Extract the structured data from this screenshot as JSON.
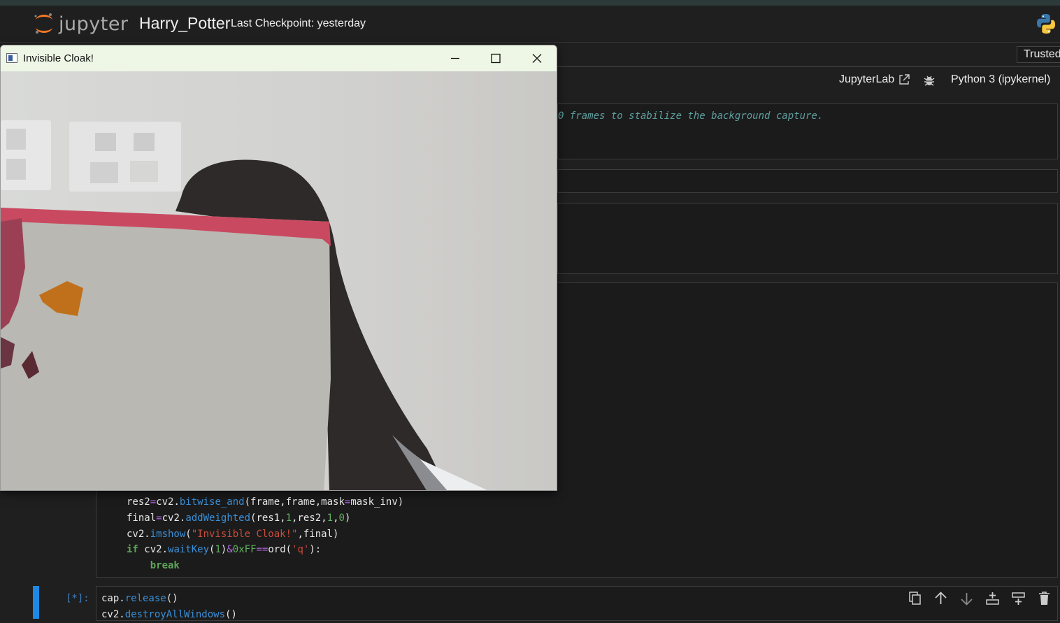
{
  "header": {
    "logo_text": "jupyter",
    "notebook_title": "Harry_Potter",
    "checkpoint": "Last Checkpoint: yesterday"
  },
  "toolbar": {
    "trusted_label": "Trusted"
  },
  "kernel_bar": {
    "jupyterlab_label": "JupyterLab",
    "kernel_name": "Python 3 (ipykernel)"
  },
  "cells": {
    "comment_fragment": "0 frames to stabilize the background capture.",
    "code_lines": [
      "res2=cv2.bitwise_and(frame,frame,mask=mask_inv)",
      "final=cv2.addWeighted(res1,1,res2,1,0)",
      "cv2.imshow(\"Invisible Cloak!\",final)",
      "if cv2.waitKey(1)&0xFF==ord('q'):",
      "    break"
    ],
    "last_cell_prompt": "[*]:",
    "last_cell_lines": [
      "cap.release()",
      "cv2.destroyAllWindows()"
    ]
  },
  "cell_toolbar": {
    "icons": [
      "duplicate-icon",
      "move-up-icon",
      "move-down-icon",
      "insert-above-icon",
      "insert-below-icon",
      "delete-icon"
    ]
  },
  "popup_window": {
    "title": "Invisible Cloak!",
    "controls": [
      "minimize-icon",
      "maximize-icon",
      "close-icon"
    ]
  },
  "colors": {
    "accent_blue": "#1e88e5",
    "jupyter_orange": "#f37726",
    "window_titlebar": "#eef7e6"
  }
}
